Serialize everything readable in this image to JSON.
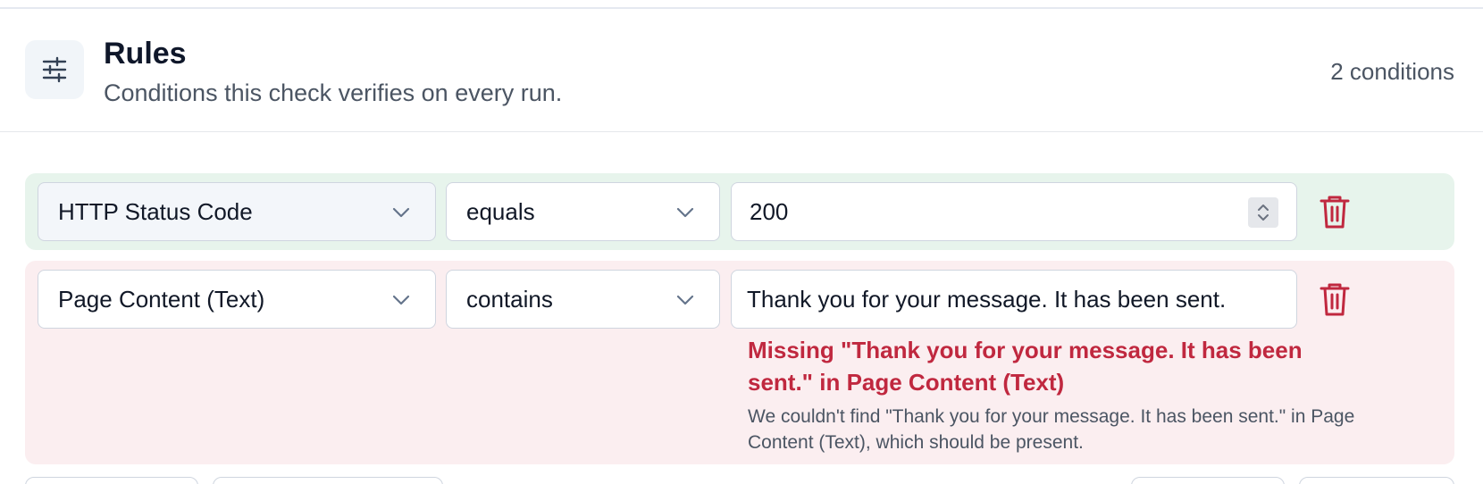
{
  "header": {
    "icon": "sliders-icon",
    "title": "Rules",
    "subtitle": "Conditions this check verifies on every run.",
    "count_label": "2 conditions"
  },
  "rules": [
    {
      "status": "pass",
      "field": "HTTP Status Code",
      "operator": "equals",
      "value": "200"
    },
    {
      "status": "fail",
      "field": "Page Content (Text)",
      "operator": "contains",
      "value": "Thank you for your message. It has been sent.",
      "error_title": "Missing \"Thank you for your message. It has been sent.\" in Page Content (Text)",
      "error_detail": "We couldn't find \"Thank you for your message. It has been sent.\" in Page Content (Text), which should be present."
    }
  ],
  "colors": {
    "pass_bg": "#e7f4ec",
    "fail_bg": "#fbeef0",
    "error_text": "#c0283f",
    "trash": "#c0283f"
  }
}
